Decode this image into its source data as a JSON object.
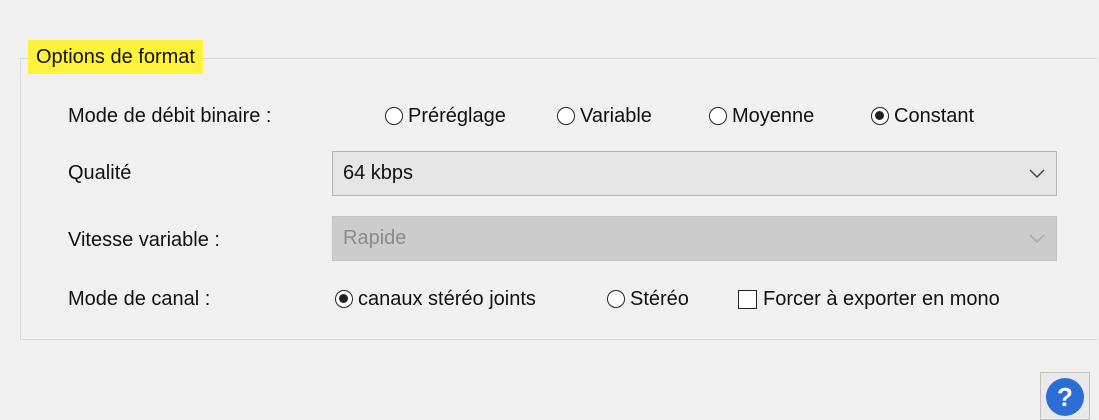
{
  "group": {
    "title": "Options de format",
    "highlight_color": "#fff23a"
  },
  "bitrate_mode": {
    "label": "Mode de débit binaire :",
    "options": [
      {
        "label": "Préréglage",
        "checked": false
      },
      {
        "label": "Variable",
        "checked": false
      },
      {
        "label": "Moyenne",
        "checked": false
      },
      {
        "label": "Constant",
        "checked": true
      }
    ]
  },
  "quality": {
    "label": "Qualité",
    "value": "64 kbps"
  },
  "variable_speed": {
    "label": "Vitesse variable :",
    "value": "Rapide",
    "disabled": true
  },
  "channel_mode": {
    "label": "Mode de canal :",
    "options": [
      {
        "label": "canaux stéréo joints",
        "checked": true
      },
      {
        "label": "Stéréo",
        "checked": false
      }
    ],
    "force_mono": {
      "label": "Forcer à exporter en mono",
      "checked": false
    }
  },
  "help": {
    "icon": "help-icon",
    "glyph": "?",
    "color": "#2b6fd6"
  }
}
